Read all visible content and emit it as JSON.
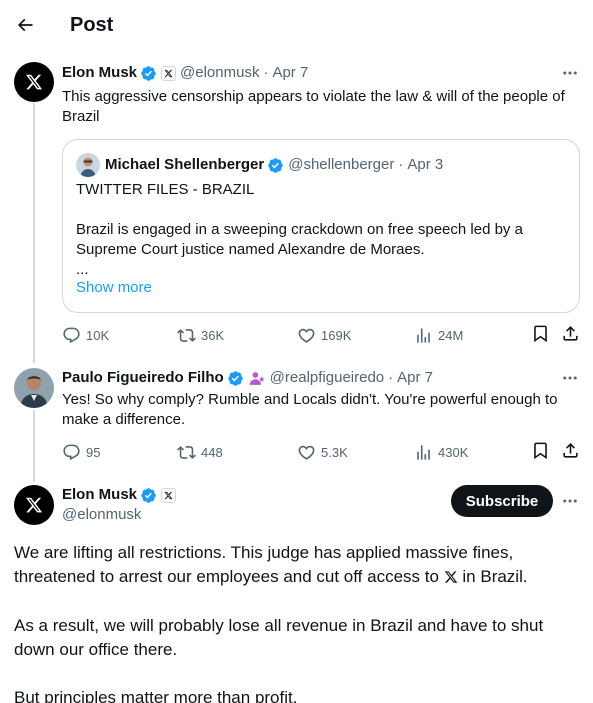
{
  "header": {
    "title": "Post"
  },
  "tweet1": {
    "name": "Elon Musk",
    "handle": "@elonmusk",
    "date": "Apr 7",
    "text_line1": "This aggressive censorship appears to violate the law & will of the people of",
    "text_line2": "Brazil",
    "quote": {
      "name": "Michael Shellenberger",
      "handle": "@shellenberger",
      "date": "Apr 3",
      "line1": "TWITTER FILES - BRAZIL",
      "line2": "Brazil is engaged in a sweeping crackdown on free speech led by a",
      "line3": "Supreme Court justice named Alexandre de Moraes.",
      "line4": "...",
      "show_more": "Show more"
    },
    "stats": {
      "replies": "10K",
      "reposts": "36K",
      "likes": "169K",
      "views": "24M"
    }
  },
  "tweet2": {
    "name": "Paulo Figueiredo Filho",
    "handle": "@realpfigueiredo",
    "date": "Apr 7",
    "text_line1": "Yes! So why comply? Rumble and Locals didn't. You're powerful enough to",
    "text_line2": "make a difference.",
    "stats": {
      "replies": "95",
      "reposts": "448",
      "likes": "5.3K",
      "views": "430K"
    }
  },
  "main_tweet": {
    "name": "Elon Musk",
    "handle": "@elonmusk",
    "subscribe_label": "Subscribe",
    "p1_line1": "We are lifting all restrictions. This judge has applied massive fines,",
    "p1_line2_a": "threatened to arrest our employees and cut off access to ",
    "p1_line2_b": " in Brazil.",
    "p2_line1": "As a result, we will probably lose all revenue in Brazil and have to shut",
    "p2_line2": "down our office there.",
    "p3_line1": "But principles matter more than profit."
  },
  "colors": {
    "accent": "#1d9bf0",
    "text": "#0f1419",
    "muted": "#536471",
    "border": "#cfd9de"
  }
}
